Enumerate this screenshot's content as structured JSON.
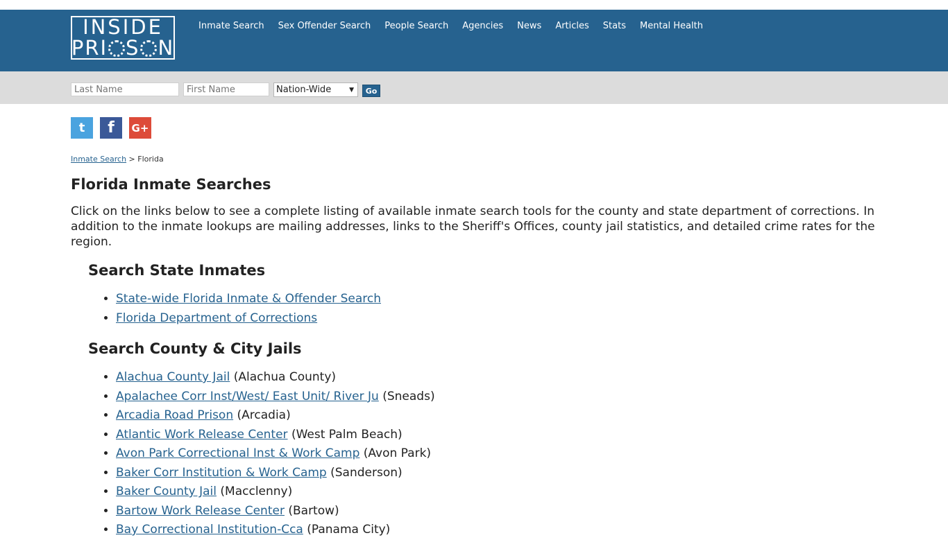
{
  "logo": {
    "line1": "INSIDE",
    "line2a": "PR",
    "line2b": "S",
    "line2c": "N"
  },
  "nav": [
    "Inmate Search",
    "Sex Offender Search",
    "People Search",
    "Agencies",
    "News",
    "Articles",
    "Stats",
    "Mental Health"
  ],
  "search": {
    "last_placeholder": "Last Name",
    "first_placeholder": "First Name",
    "scope_selected": "Nation-Wide",
    "go_label": "Go"
  },
  "social": {
    "twitter": "t",
    "facebook": "f",
    "google": "G+"
  },
  "breadcrumb": {
    "link": "Inmate Search",
    "sep": ">",
    "current": "Florida"
  },
  "page": {
    "title": "Florida Inmate Searches",
    "intro": "Click on the links below to see a complete listing of available inmate search tools for the county and state department of corrections. In addition to the inmate lookups are mailing addresses, links to the Sheriff's Offices, county jail statistics, and detailed crime rates for the region."
  },
  "state_section": {
    "heading": "Search State Inmates",
    "links": [
      "State-wide Florida Inmate & Offender Search",
      "Florida Department of Corrections"
    ]
  },
  "county_section": {
    "heading": "Search County & City Jails",
    "items": [
      {
        "name": "Alachua County Jail",
        "loc": "(Alachua County)"
      },
      {
        "name": "Apalachee Corr Inst/West/ East Unit/ River Ju",
        "loc": "(Sneads)"
      },
      {
        "name": "Arcadia Road Prison",
        "loc": "(Arcadia)"
      },
      {
        "name": "Atlantic Work Release Center",
        "loc": "(West Palm Beach)"
      },
      {
        "name": "Avon Park Correctional Inst & Work Camp",
        "loc": "(Avon Park)"
      },
      {
        "name": "Baker Corr Institution & Work Camp",
        "loc": "(Sanderson)"
      },
      {
        "name": "Baker County Jail",
        "loc": "(Macclenny)"
      },
      {
        "name": "Bartow Work Release Center",
        "loc": "(Bartow)"
      },
      {
        "name": "Bay Correctional Institution-Cca",
        "loc": "(Panama City)"
      }
    ]
  },
  "colors": {
    "header": "#26628f",
    "searchbar": "#dcdcdc",
    "link": "#26628f"
  }
}
